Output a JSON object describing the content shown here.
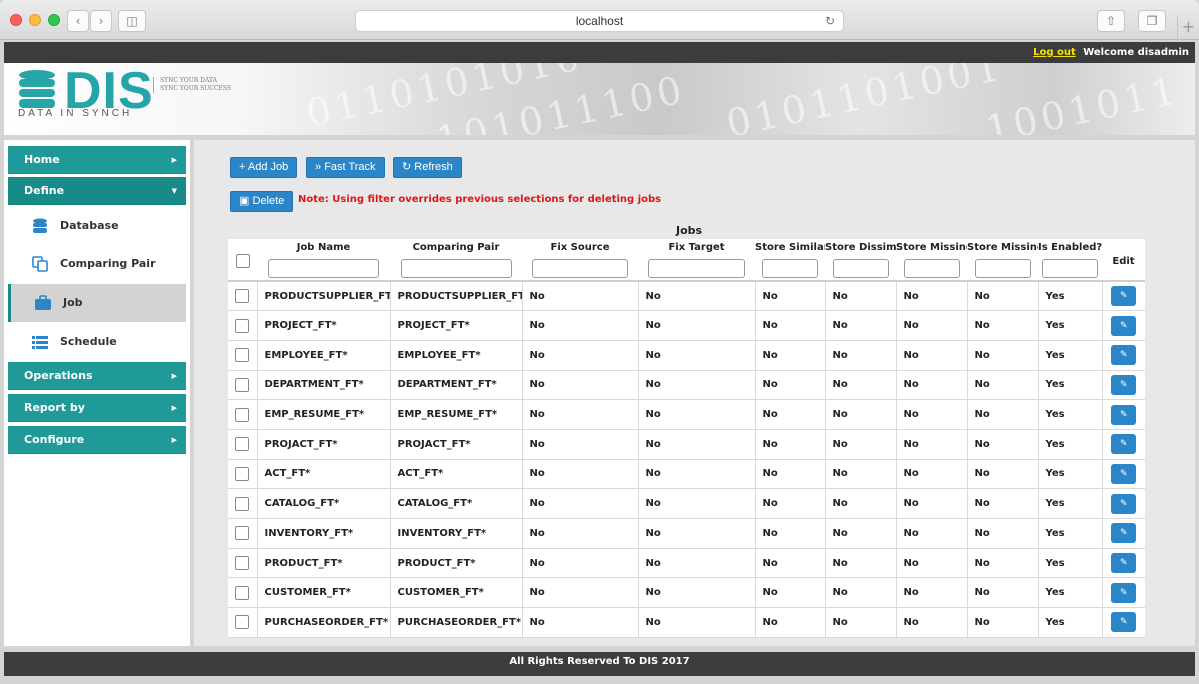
{
  "browser": {
    "url": "localhost"
  },
  "topbar": {
    "logout": "Log out",
    "welcome": "Welcome disadmin"
  },
  "logo": {
    "name": "DIS",
    "subtitle": "DATA IN SYNCH",
    "tagline1": "SYNC YOUR DATA",
    "tagline2": "SYNC YOUR SUCCESS"
  },
  "sidebar": {
    "home": "Home",
    "define": "Define",
    "define_items": [
      "Database",
      "Comparing Pair",
      "Job",
      "Schedule"
    ],
    "operations": "Operations",
    "report_by": "Report by",
    "configure": "Configure"
  },
  "toolbar": {
    "add_job": "+ Add Job",
    "fast_track": "Fast Track",
    "refresh": "Refresh",
    "delete": "Delete",
    "note": "Note: Using filter overrides previous selections for deleting jobs"
  },
  "table": {
    "title": "Jobs",
    "columns": [
      "Job Name",
      "Comparing Pair",
      "Fix Source",
      "Fix Target",
      "Store Similar",
      "Store Dissim",
      "Store Missing",
      "Store Missing",
      "Is Enabled?",
      "Edit"
    ],
    "rows": [
      [
        "PRODUCTSUPPLIER_FT*",
        "PRODUCTSUPPLIER_FT*",
        "No",
        "No",
        "No",
        "No",
        "No",
        "No",
        "Yes"
      ],
      [
        "PROJECT_FT*",
        "PROJECT_FT*",
        "No",
        "No",
        "No",
        "No",
        "No",
        "No",
        "Yes"
      ],
      [
        "EMPLOYEE_FT*",
        "EMPLOYEE_FT*",
        "No",
        "No",
        "No",
        "No",
        "No",
        "No",
        "Yes"
      ],
      [
        "DEPARTMENT_FT*",
        "DEPARTMENT_FT*",
        "No",
        "No",
        "No",
        "No",
        "No",
        "No",
        "Yes"
      ],
      [
        "EMP_RESUME_FT*",
        "EMP_RESUME_FT*",
        "No",
        "No",
        "No",
        "No",
        "No",
        "No",
        "Yes"
      ],
      [
        "PROJACT_FT*",
        "PROJACT_FT*",
        "No",
        "No",
        "No",
        "No",
        "No",
        "No",
        "Yes"
      ],
      [
        "ACT_FT*",
        "ACT_FT*",
        "No",
        "No",
        "No",
        "No",
        "No",
        "No",
        "Yes"
      ],
      [
        "CATALOG_FT*",
        "CATALOG_FT*",
        "No",
        "No",
        "No",
        "No",
        "No",
        "No",
        "Yes"
      ],
      [
        "INVENTORY_FT*",
        "INVENTORY_FT*",
        "No",
        "No",
        "No",
        "No",
        "No",
        "No",
        "Yes"
      ],
      [
        "PRODUCT_FT*",
        "PRODUCT_FT*",
        "No",
        "No",
        "No",
        "No",
        "No",
        "No",
        "Yes"
      ],
      [
        "CUSTOMER_FT*",
        "CUSTOMER_FT*",
        "No",
        "No",
        "No",
        "No",
        "No",
        "No",
        "Yes"
      ],
      [
        "PURCHASEORDER_FT*",
        "PURCHASEORDER_FT*",
        "No",
        "No",
        "No",
        "No",
        "No",
        "No",
        "Yes"
      ]
    ]
  },
  "footer": {
    "text": "All Rights Reserved To DIS 2017"
  },
  "colors": {
    "teal": "#1f9a98",
    "button_blue": "#2b86c9",
    "note_red": "#e01616",
    "bar_dark": "#3c3c3c"
  }
}
